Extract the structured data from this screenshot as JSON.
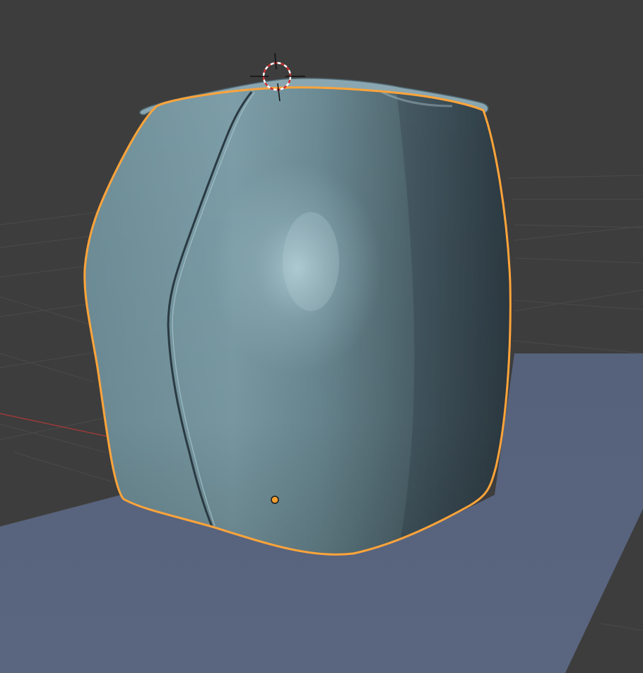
{
  "app": {
    "name": "3D Viewport"
  },
  "theme": {
    "background": "#3d3d3d",
    "grid_line": "#4a4a4a",
    "x_axis": "#9c3a3a",
    "floor_plane": "#5a6680",
    "mesh_base": "#6f8f9a",
    "mesh_highlight": "#9fc0ca",
    "mesh_shadow": "#2f3d44",
    "selection_outline": "#ffa43a",
    "origin_point": "#f5a030"
  },
  "scene": {
    "selected_object": {
      "shape": "rounded box with cloth fold",
      "selected": true
    },
    "icons": {
      "cursor": "3d-cursor-icon",
      "origin": "object-origin-icon"
    }
  }
}
